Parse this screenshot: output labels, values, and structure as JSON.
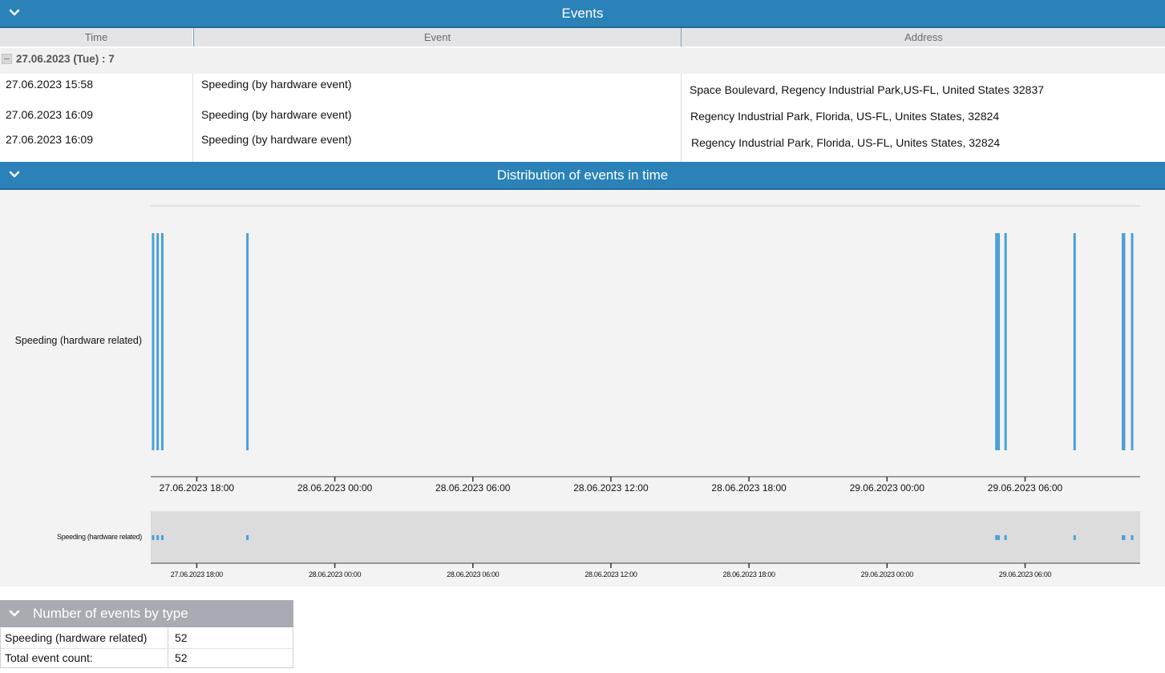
{
  "events_panel": {
    "title": "Events",
    "columns": [
      "Time",
      "Event",
      "Address"
    ],
    "group_label": "27.06.2023 (Tue) : 7",
    "rows": [
      {
        "time": "27.06.2023 15:58",
        "event": "Speeding (by hardware event)",
        "address": "Space Boulevard, Regency Industrial Park,US-FL, United States 32837"
      },
      {
        "time": "27.06.2023 16:09",
        "event": "Speeding (by hardware event)",
        "address": "Regency Industrial Park, Florida, US-FL, Unites States, 32824"
      },
      {
        "time": "27.06.2023 16:09",
        "event": "Speeding (by hardware event)",
        "address": "Regency Industrial Park, Florida, US-FL, Unites States, 32824"
      }
    ]
  },
  "distribution_panel": {
    "title": "Distribution of events in time",
    "row_label": "Speeding (hardware related)",
    "nav_row_label": "Speeding (hardware related)",
    "accent_color": "#4a9fd8"
  },
  "chart_data": {
    "type": "scatter",
    "title": "Distribution of events in time",
    "series": [
      {
        "name": "Speeding (hardware related)",
        "x_hours_from_axis_start": [
          0.05,
          0.25,
          0.45,
          4.15,
          36.7,
          36.8,
          37.1,
          40.1,
          42.2,
          42.25,
          42.6
        ]
      }
    ],
    "x_axis": {
      "type": "time",
      "start": "27.06.2023 16:00",
      "end": "29.06.2023 11:00",
      "tick_labels": [
        "27.06.2023 18:00",
        "28.06.2023 00:00",
        "28.06.2023 06:00",
        "28.06.2023 12:00",
        "28.06.2023 18:00",
        "29.06.2023 00:00",
        "29.06.2023 06:00"
      ],
      "tick_hours_from_start": [
        2,
        8,
        14,
        20,
        26,
        32,
        38
      ]
    },
    "y_axis": {
      "categories": [
        "Speeding (hardware related)"
      ]
    },
    "grid": false
  },
  "summary_panel": {
    "title": "Number of events by type",
    "rows": [
      {
        "label": "Speeding (hardware related)",
        "value": "52"
      },
      {
        "label": "Total event count:",
        "value": "52"
      }
    ]
  }
}
